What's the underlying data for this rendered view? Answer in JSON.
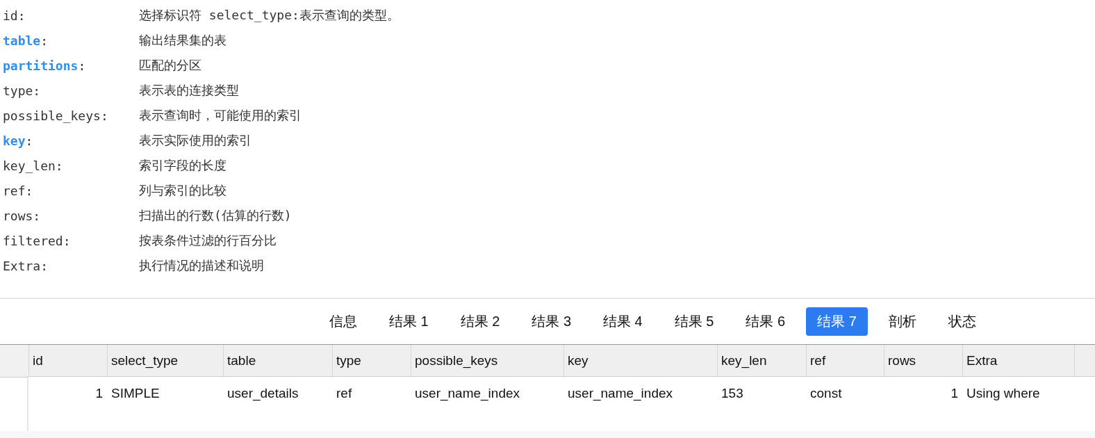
{
  "doc_lines": [
    {
      "key": "id",
      "sep": ":",
      "description": "选择标识符 select_type:表示查询的类型。",
      "highlighted": false
    },
    {
      "key": "table",
      "sep": ":",
      "description": "输出结果集的表",
      "highlighted": true
    },
    {
      "key": "partitions",
      "sep": ":",
      "description": "匹配的分区",
      "highlighted": true
    },
    {
      "key": "type",
      "sep": ":",
      "description": "表示表的连接类型",
      "highlighted": false
    },
    {
      "key": "possible_keys",
      "sep": ":",
      "description": "表示查询时，可能使用的索引",
      "highlighted": false
    },
    {
      "key": "key",
      "sep": ":",
      "description": "表示实际使用的索引",
      "highlighted": true
    },
    {
      "key": "key_len",
      "sep": ":",
      "description": "索引字段的长度",
      "highlighted": false
    },
    {
      "key": "ref",
      "sep": ":",
      "description": "列与索引的比较",
      "highlighted": false
    },
    {
      "key": "rows",
      "sep": ":",
      "description": "扫描出的行数(估算的行数)",
      "highlighted": false
    },
    {
      "key": "filtered",
      "sep": ":",
      "description": "按表条件过滤的行百分比",
      "highlighted": false
    },
    {
      "key": "Extra",
      "sep": ":",
      "description": "执行情况的描述和说明",
      "highlighted": false
    }
  ],
  "tabs": [
    {
      "label": "信息",
      "selected": false
    },
    {
      "label": "结果 1",
      "selected": false
    },
    {
      "label": "结果 2",
      "selected": false
    },
    {
      "label": "结果 3",
      "selected": false
    },
    {
      "label": "结果 4",
      "selected": false
    },
    {
      "label": "结果 5",
      "selected": false
    },
    {
      "label": "结果 6",
      "selected": false
    },
    {
      "label": "结果 7",
      "selected": true
    },
    {
      "label": "剖析",
      "selected": false
    },
    {
      "label": "状态",
      "selected": false
    }
  ],
  "table": {
    "columns": [
      {
        "label": "id",
        "numeric": true
      },
      {
        "label": "select_type",
        "numeric": false
      },
      {
        "label": "table",
        "numeric": false
      },
      {
        "label": "type",
        "numeric": false
      },
      {
        "label": "possible_keys",
        "numeric": false
      },
      {
        "label": "key",
        "numeric": false
      },
      {
        "label": "key_len",
        "numeric": false
      },
      {
        "label": "ref",
        "numeric": false
      },
      {
        "label": "rows",
        "numeric": true
      },
      {
        "label": "Extra",
        "numeric": false
      }
    ],
    "rows": [
      [
        "1",
        "SIMPLE",
        "user_details",
        "ref",
        "user_name_index",
        "user_name_index",
        "153",
        "const",
        "1",
        "Using where"
      ]
    ]
  }
}
